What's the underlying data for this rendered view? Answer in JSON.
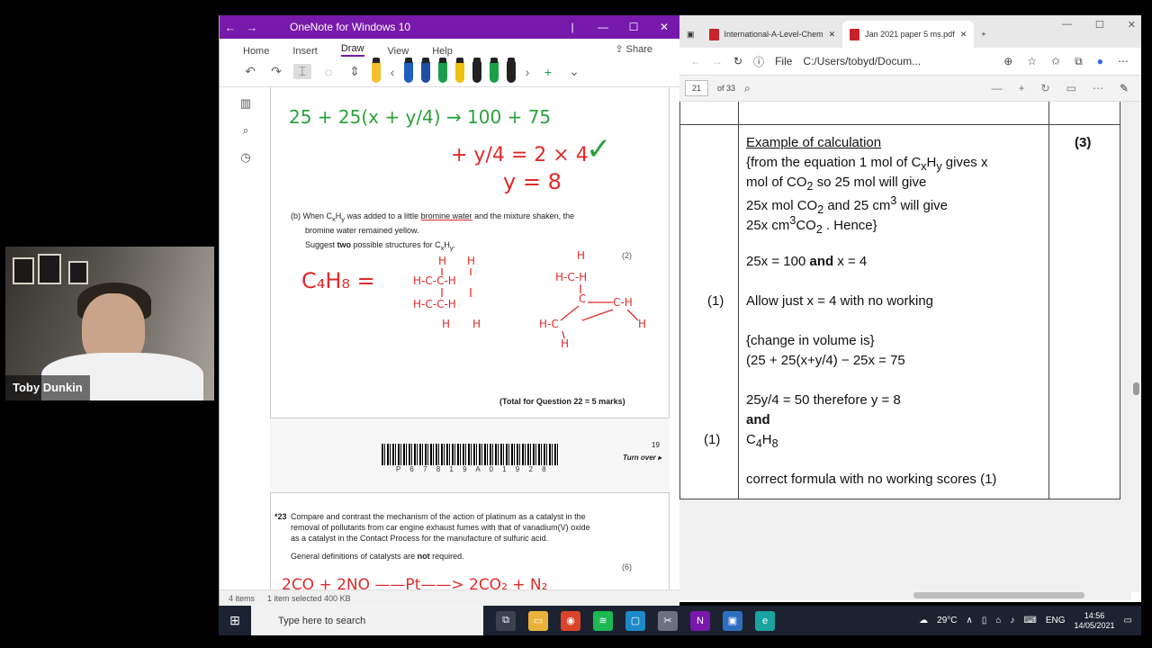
{
  "webcam": {
    "name": "Toby Dunkin"
  },
  "onenote": {
    "title": "OneNote for Windows 10",
    "tabs": [
      "Home",
      "Insert",
      "Draw",
      "View",
      "Help"
    ],
    "active_tab": "Draw",
    "share_label": "Share",
    "status": {
      "items": "4 items",
      "selected": "1 item selected  400 KB"
    },
    "pen_colors": [
      "#f4c030",
      "#d58ad8",
      "#1f5fbf",
      "#1f4fa0",
      "#1d9e4a",
      "#f0c010",
      "#222222",
      "#1d9e4a",
      "#222222"
    ]
  },
  "worksheet": {
    "hand_line1": "25 +   25(x + y/4) → 100 + 75",
    "hand_line2a": "+ y/4 = 2 × 4",
    "hand_line2b": "y = 8",
    "q_b_1": "(b) When C",
    "q_b_sub1": "x",
    "q_b_2": "H",
    "q_b_sub2": "y",
    "q_b_3": " was added to a little ",
    "q_b_underlined": "bromine water",
    "q_b_4": " and the mixture shaken, the",
    "q_b_line2": "bromine water remained yellow.",
    "q_suggest_1": "Suggest ",
    "q_suggest_bold": "two",
    "q_suggest_2": " possible structures for C",
    "q_suggest_sub1": "x",
    "q_suggest_3": "H",
    "q_suggest_sub2": "y",
    "q_suggest_4": ".",
    "marks_2": "(2)",
    "formula": "C₄H₈ =",
    "total": "(Total for Question 22 = 5 marks)",
    "page_num": "19",
    "turn_over": "Turn over ▸",
    "barcode_num": "P 6 7 8 1 9 A 0 1 9 2 8",
    "q23_num": "*23",
    "q23_line1": "Compare and contrast the mechanism of the action of platinum as a catalyst in the",
    "q23_line2": "removal of pollutants from car engine exhaust fumes with that of vanadium(V) oxide",
    "q23_line3": "as a catalyst in the Contact Process for the manufacture of sulfuric acid.",
    "q23_line4a": "General definitions of catalysts are ",
    "q23_line4_bold": "not",
    "q23_line4b": " required.",
    "marks_6": "(6)",
    "hand_bottom": "2CO + 2NO ——Pt——> 2CO₂ + N₂"
  },
  "edge": {
    "tab1": "International-A-Level-Chem",
    "tab2": "Jan 2021 paper 5 ms.pdf",
    "url_label": "File",
    "url": "C:/Users/tobyd/Docum...",
    "page_current": "21",
    "page_total": "of 33"
  },
  "markscheme": {
    "heading": "Example of calculation",
    "mark_total": "(3)",
    "line1a": "{from the equation 1 mol of C",
    "line1_sub_x": "x",
    "line1b": "H",
    "line1_sub_y": "y",
    "line1c": " gives x",
    "line2a": "mol of CO",
    "line2_sub": "2",
    "line2b": " so 25 mol will give",
    "line3a": "25x mol CO",
    "line3_sub": "2",
    "line3b": " and 25 cm",
    "line3_sup": "3",
    "line3c": " will give",
    "line4a": "25x cm",
    "line4_sup": "3",
    "line4b": "CO",
    "line4_sub": "2",
    "line4c": " . Hence}",
    "line5a": "25x = 100 ",
    "line5_bold": "and",
    "line5b": " x = 4",
    "mark1": "(1)",
    "line6": "Allow just x = 4 with no working",
    "line7": "{change in volume is}",
    "line8": "(25 + 25(x+y/4) − 25x = 75",
    "line9": "25y/4 = 50 therefore y = 8",
    "line10_bold": "and",
    "mark2": "(1)",
    "line11a": "C",
    "line11_sub1": "4",
    "line11b": "H",
    "line11_sub2": "8",
    "line12": "correct formula with no working scores (1)"
  },
  "taskbar": {
    "search_placeholder": "Type here to search",
    "temp": "29°C",
    "lang": "ENG",
    "time": "14:56",
    "date": "14/05/2021"
  }
}
